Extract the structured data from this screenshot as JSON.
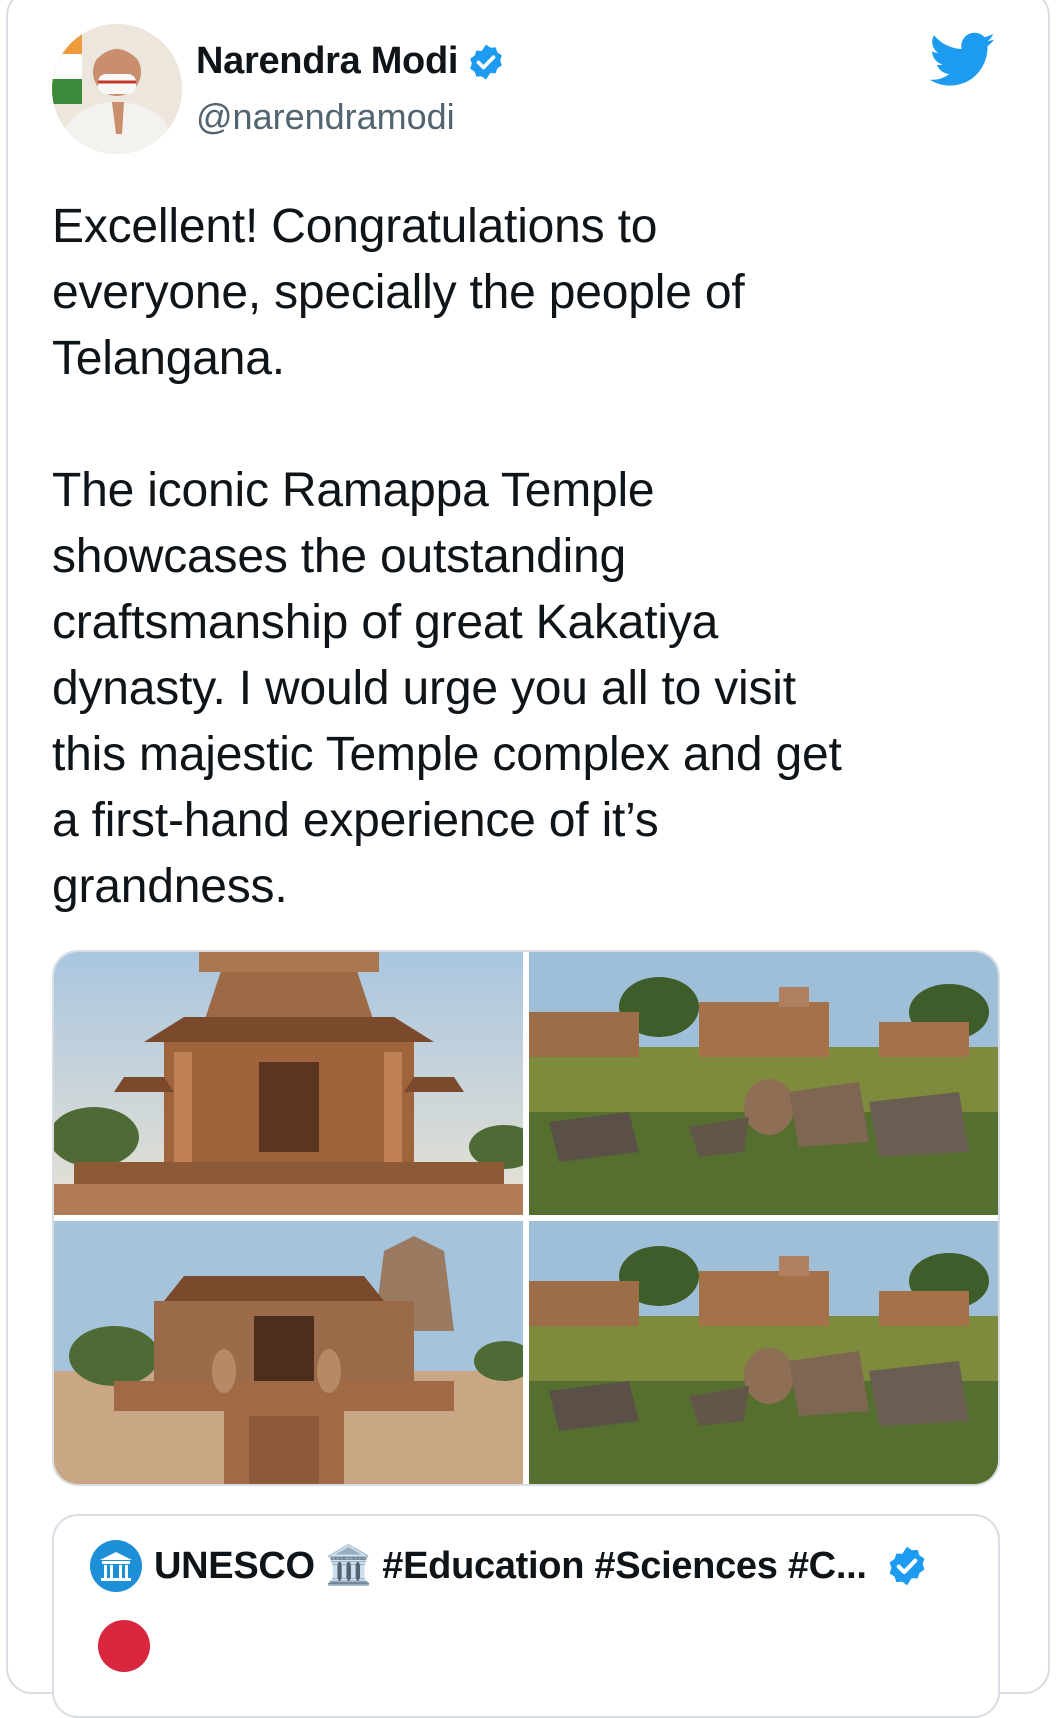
{
  "author": {
    "display_name": "Narendra Modi",
    "handle": "@narendramodi",
    "verified": true,
    "avatar_icon": "profile-photo"
  },
  "brand": {
    "icon": "twitter-bird-icon",
    "color": "#1d9bf0"
  },
  "tweet": {
    "text": "Excellent! Congratulations to\neveryone, specially the people of\nTelangana.\n\nThe iconic Ramappa Temple\nshowcases the outstanding\ncraftsmanship of great Kakatiya\ndynasty. I would urge you all to visit\nthis majestic Temple complex and get\na first-hand experience of it’s\ngrandness."
  },
  "media": {
    "photos": [
      {
        "subject": "Ramappa Temple front view"
      },
      {
        "subject": "Temple ruins in grassy field"
      },
      {
        "subject": "Temple entrance with Nandi statues"
      },
      {
        "subject": "Temple ruins in grassy field"
      }
    ]
  },
  "quoted_tweet": {
    "display_name": "UNESCO 🏛️ #Education #Sciences #C...",
    "verified": true
  }
}
